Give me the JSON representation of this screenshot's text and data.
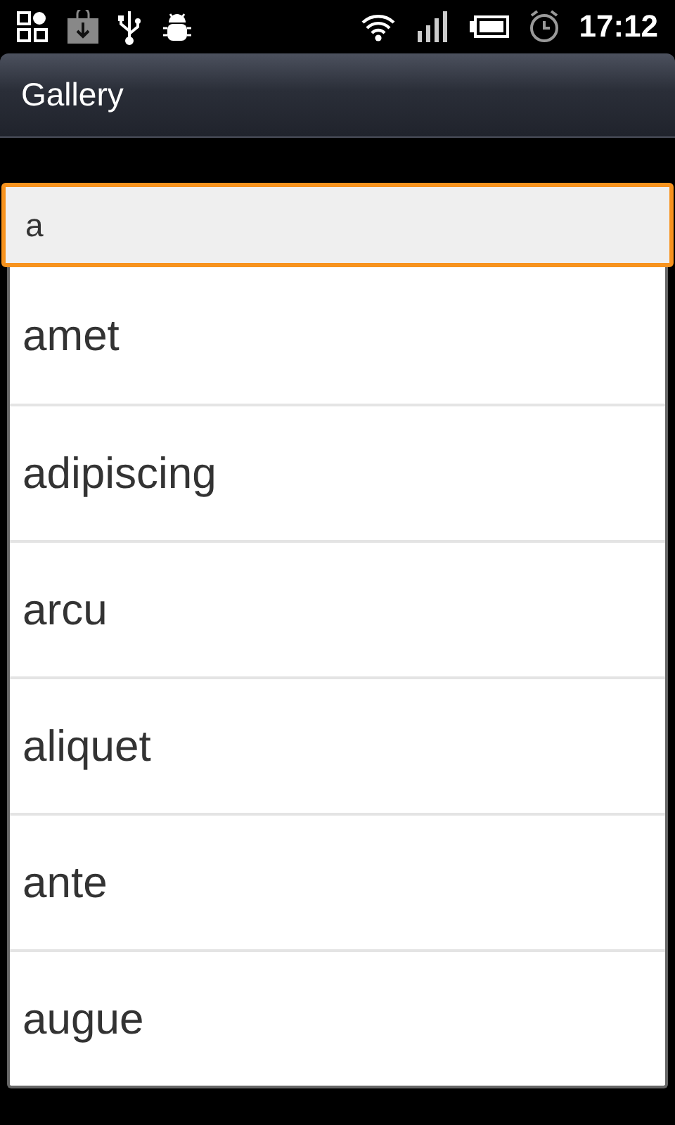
{
  "status_bar": {
    "time": "17:12"
  },
  "title_bar": {
    "title": "Gallery"
  },
  "search": {
    "value": "a",
    "focused": true
  },
  "suggestions": [
    {
      "label": "amet"
    },
    {
      "label": "adipiscing"
    },
    {
      "label": "arcu"
    },
    {
      "label": "aliquet"
    },
    {
      "label": "ante"
    },
    {
      "label": "augue"
    }
  ]
}
